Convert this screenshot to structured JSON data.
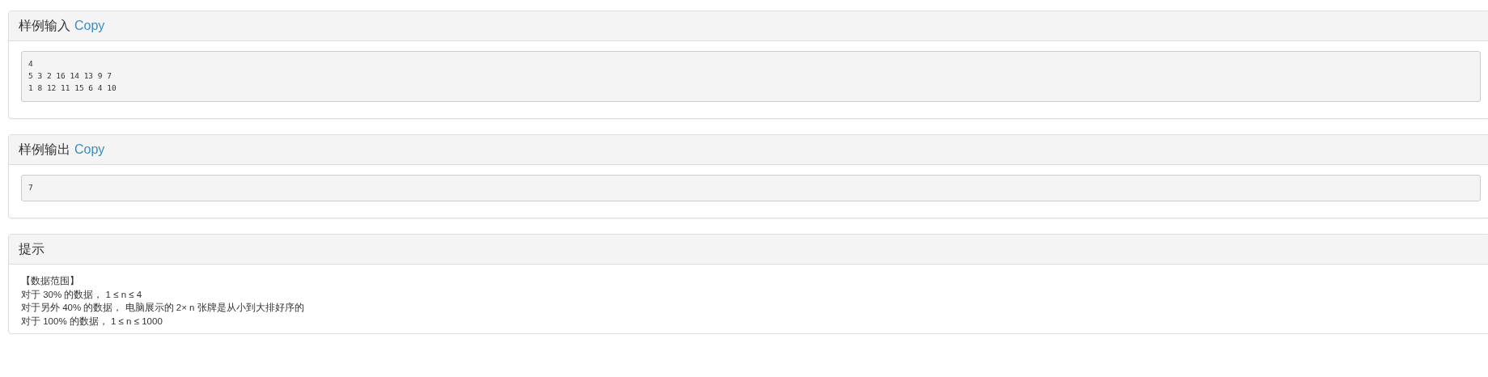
{
  "panels": [
    {
      "kind": "code",
      "title": "样例输入",
      "copy_label": "Copy",
      "code_lines": [
        "4",
        "5 3 2 16 14 13 9 7",
        "1 8 12 11 15 6 4 10"
      ]
    },
    {
      "kind": "code",
      "title": "样例输出",
      "copy_label": "Copy",
      "code_lines": [
        "7"
      ]
    },
    {
      "kind": "text",
      "title": "提示",
      "text_lines": [
        "【数据范围】",
        "对于 30% 的数据， 1 ≤ n ≤ 4",
        "对于另外 40% 的数据， 电脑展示的 2× n 张牌是从小到大排好序的",
        "对于 100% 的数据， 1 ≤ n ≤ 1000"
      ]
    }
  ]
}
